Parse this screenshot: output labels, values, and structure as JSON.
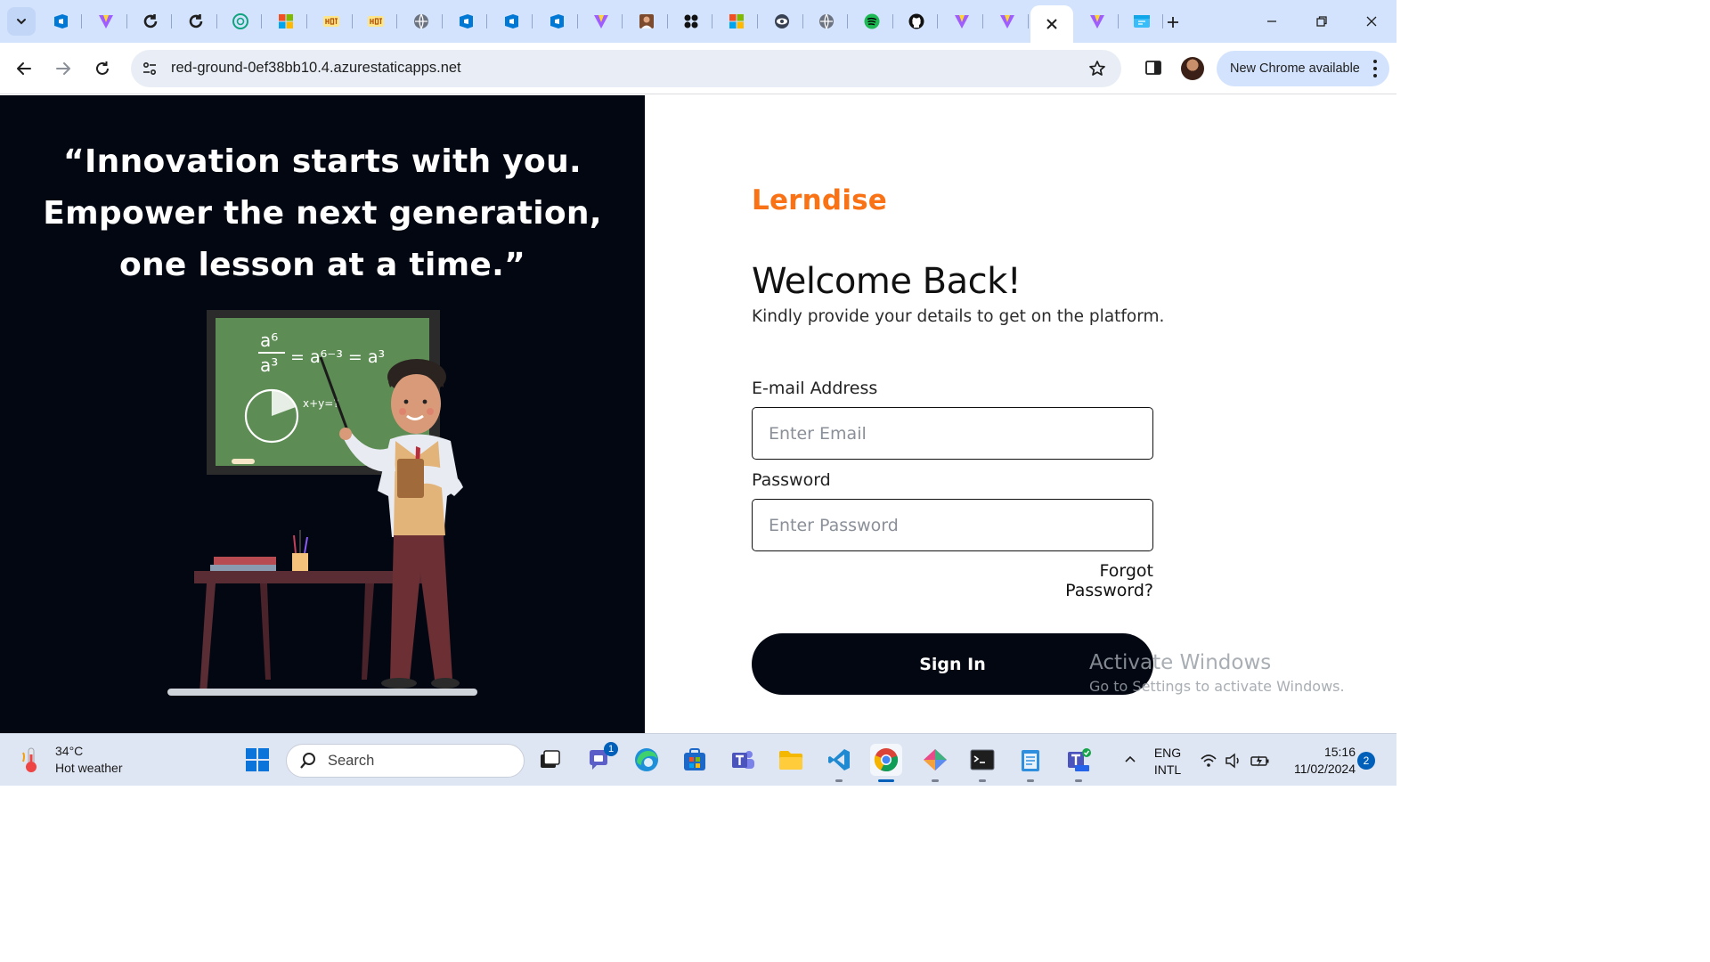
{
  "browser": {
    "tabs": [
      {
        "icon": "azure-devops-icon",
        "color": "#0078d4"
      },
      {
        "icon": "vite-icon",
        "color": "#9f5cff"
      },
      {
        "icon": "refresh-circle-icon",
        "color": "#1f1f1f"
      },
      {
        "icon": "refresh-circle-icon",
        "color": "#1f1f1f"
      },
      {
        "icon": "chatgpt-icon",
        "color": "#10a37f"
      },
      {
        "icon": "microsoft-icon",
        "color": "#f25022"
      },
      {
        "icon": "hot-icon",
        "color": "#b45309"
      },
      {
        "icon": "hot-icon",
        "color": "#b45309"
      },
      {
        "icon": "globe-icon",
        "color": "#6b7280"
      },
      {
        "icon": "azure-devops-icon",
        "color": "#0078d4"
      },
      {
        "icon": "azure-devops-icon",
        "color": "#0078d4"
      },
      {
        "icon": "azure-devops-icon",
        "color": "#0078d4"
      },
      {
        "icon": "vite-icon",
        "color": "#9f5cff"
      },
      {
        "icon": "avatar-icon",
        "color": "#7c4a2d"
      },
      {
        "icon": "apps-grid-icon",
        "color": "#111111"
      },
      {
        "icon": "microsoft-icon",
        "color": "#f25022"
      },
      {
        "icon": "eye-icon",
        "color": "#374151"
      },
      {
        "icon": "globe-icon",
        "color": "#6b7280"
      },
      {
        "icon": "spotify-icon",
        "color": "#1db954"
      },
      {
        "icon": "github-icon",
        "color": "#111111"
      },
      {
        "icon": "vite-icon",
        "color": "#9f5cff"
      },
      {
        "icon": "vite-icon",
        "color": "#9f5cff"
      },
      {
        "icon": "close-icon",
        "color": "#1f1f1f",
        "active": true
      },
      {
        "icon": "vite-icon",
        "color": "#9f5cff"
      },
      {
        "icon": "static-web-app-icon",
        "color": "#38bdf8"
      }
    ],
    "url": "red-ground-0ef38bb10.4.azurestaticapps.net",
    "update_label": "New Chrome available"
  },
  "left": {
    "quote": "“Innovation starts with you. Empower the next generation, one lesson at a time.”",
    "chalkboard": {
      "formula_top": "a⁶",
      "formula_bottom": "a³",
      "formula_rest": "= a⁶⁻³ = a³",
      "formula_small": "x+y=?"
    }
  },
  "login": {
    "brand": "Lerndise",
    "heading": "Welcome Back!",
    "subtitle": "Kindly provide your details to get on the platform.",
    "email_label": "E-mail Address",
    "email_placeholder": "Enter Email",
    "email_value": "",
    "password_label": "Password",
    "password_placeholder": "Enter Password",
    "password_value": "",
    "forgot_label": "Forgot Password?",
    "signin_label": "Sign In",
    "brand_color": "#f97316"
  },
  "watermark": {
    "title": "Activate Windows",
    "subtitle": "Go to Settings to activate Windows."
  },
  "taskbar": {
    "weather_temp": "34°C",
    "weather_desc": "Hot weather",
    "search_label": "Search",
    "chat_badge": "1",
    "lang_1": "ENG",
    "lang_2": "INTL",
    "time": "15:16",
    "date": "11/02/2024",
    "notifications": "2"
  }
}
